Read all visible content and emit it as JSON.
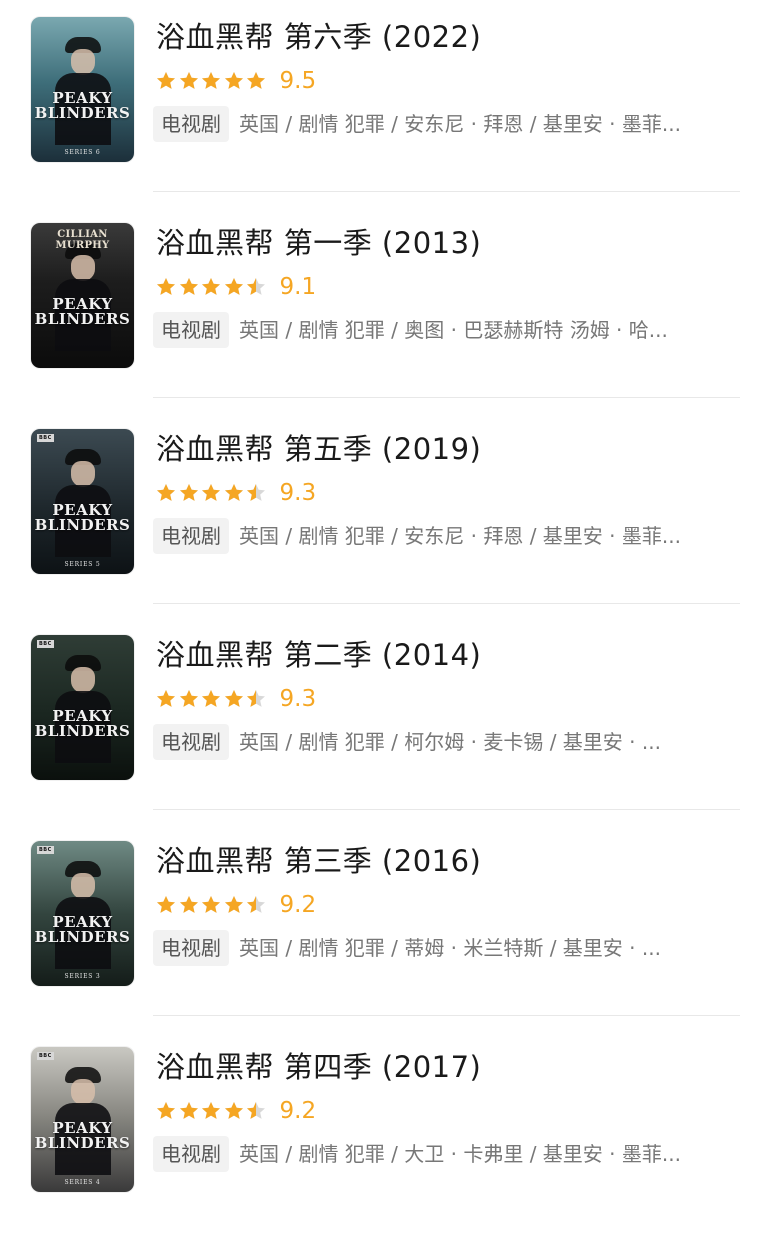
{
  "colors": {
    "star": "#f5a623",
    "star_empty": "#d8d8d8",
    "score": "#f5a623",
    "title": "#1a1a1a",
    "tag_bg": "#f2f2f2"
  },
  "items": [
    {
      "title": "浴血黑帮 第六季 (2022)",
      "rating": 5,
      "score": "9.5",
      "tag": "电视剧",
      "meta": "英国 / 剧情 犯罪 / 安东尼 · 拜恩 / 基里安 · 墨菲...",
      "poster": {
        "bg": "linear-gradient(180deg,#7aa8b0 0%,#3e6e7a 45%,#1c2f3a 100%)",
        "top_text": "",
        "logo_text": "PEAKY\nBLINDERS",
        "bottom_text": "SERIES 6",
        "bbc": false
      }
    },
    {
      "title": "浴血黑帮 第一季 (2013)",
      "rating": 4.5,
      "score": "9.1",
      "tag": "电视剧",
      "meta": "英国 / 剧情 犯罪 / 奥图 · 巴瑟赫斯特 汤姆 · 哈...",
      "poster": {
        "bg": "linear-gradient(180deg,#3a3a3a 0%,#1d1d1d 40%,#0b0b0b 100%)",
        "top_text": "CILLIAN MURPHY",
        "logo_text": "PEAKY\nBLINDERS",
        "bottom_text": "",
        "bbc": false
      }
    },
    {
      "title": "浴血黑帮 第五季 (2019)",
      "rating": 4.5,
      "score": "9.3",
      "tag": "电视剧",
      "meta": "英国 / 剧情 犯罪 / 安东尼 · 拜恩 / 基里安 · 墨菲...",
      "poster": {
        "bg": "linear-gradient(180deg,#3c4a52 0%,#1e272c 55%,#0d1215 100%)",
        "top_text": "",
        "logo_text": "PEAKY\nBLINDERS",
        "bottom_text": "SERIES 5",
        "bbc": true
      }
    },
    {
      "title": "浴血黑帮 第二季 (2014)",
      "rating": 4.5,
      "score": "9.3",
      "tag": "电视剧",
      "meta": "英国 / 剧情 犯罪 / 柯尔姆 · 麦卡锡 / 基里安 · ...",
      "poster": {
        "bg": "linear-gradient(180deg,#2f3d36 0%,#1a2620 55%,#0b100d 100%)",
        "top_text": "",
        "logo_text": "PEAKY\nBLINDERS",
        "bottom_text": "",
        "bbc": true
      }
    },
    {
      "title": "浴血黑帮 第三季 (2016)",
      "rating": 4.5,
      "score": "9.2",
      "tag": "电视剧",
      "meta": "英国 / 剧情 犯罪 / 蒂姆 · 米兰特斯 / 基里安 · ...",
      "poster": {
        "bg": "linear-gradient(180deg,#6f8a84 0%,#33453f 50%,#141c19 100%)",
        "top_text": "",
        "logo_text": "PEAKY\nBLINDERS",
        "bottom_text": "SERIES 3",
        "bbc": true
      }
    },
    {
      "title": "浴血黑帮 第四季 (2017)",
      "rating": 4.5,
      "score": "9.2",
      "tag": "电视剧",
      "meta": "英国 / 剧情 犯罪 / 大卫 · 卡弗里 / 基里安 · 墨菲...",
      "poster": {
        "bg": "linear-gradient(180deg,#c9c8c2 0%,#8b8a84 45%,#3a3a3a 100%)",
        "top_text": "",
        "logo_text": "PEAKY\nBLINDERS",
        "bottom_text": "SERIES 4",
        "bbc": true
      }
    }
  ]
}
